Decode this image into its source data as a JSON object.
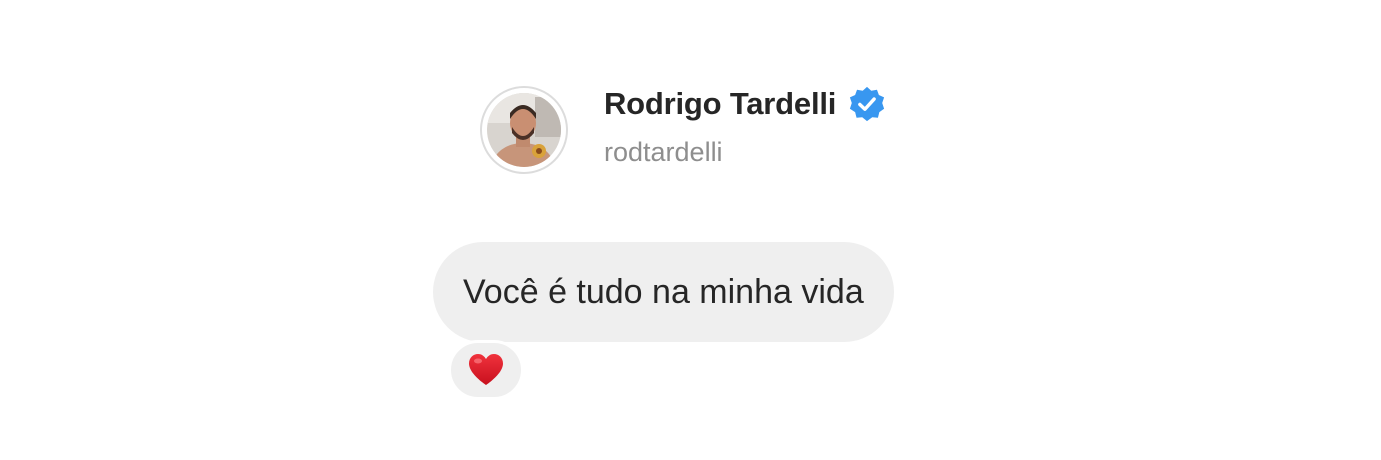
{
  "profile": {
    "display_name": "Rodrigo Tardelli",
    "username": "rodtardelli",
    "verified_icon": "verified-badge-icon",
    "verified_color": "#3897f0"
  },
  "message": {
    "text": "Você é tudo na minha vida",
    "bubble_color": "#efefef"
  },
  "reaction": {
    "icon": "heart-icon",
    "color": "#e0202b"
  }
}
